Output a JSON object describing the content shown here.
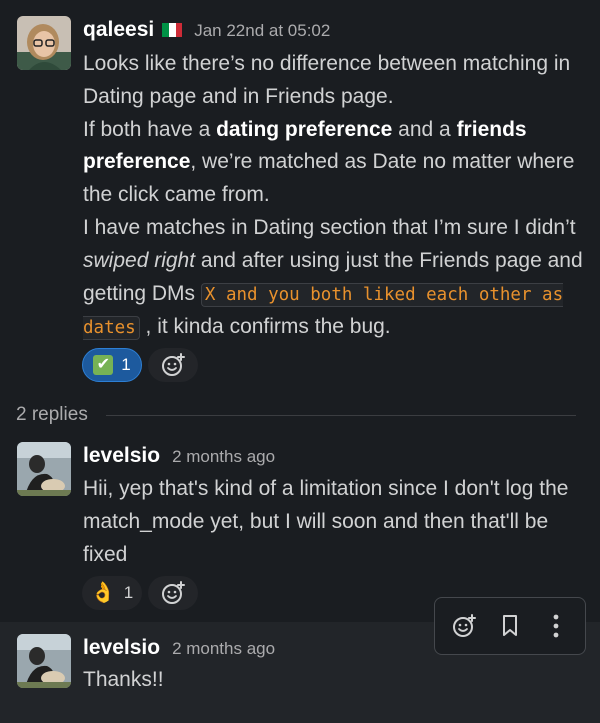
{
  "message1": {
    "author": "qaleesi",
    "flag_colors": [
      "#009246",
      "#ffffff",
      "#ce2b37"
    ],
    "timestamp": "Jan 22nd at 05:02",
    "p1": "Looks like there’s no difference between matching in Dating page and in Friends page.",
    "p2_a": "If both have a ",
    "p2_b": "dating preference",
    "p2_c": " and a ",
    "p2_d": "friends preference",
    "p2_e": ", we’re matched as Date no matter where the click came from.",
    "p3_a": "I have matches in Dating section that I’m sure I didn’t ",
    "p3_b": "swiped right",
    "p3_c": " and after using just the Friends page and getting DMs ",
    "p3_code": "X and you both liked each other as dates",
    "p3_d": " , it kinda  confirms the bug.",
    "reaction": {
      "emoji": "✔",
      "count": "1"
    }
  },
  "thread": {
    "replies_label": "2 replies"
  },
  "reply1": {
    "author": "levelsio",
    "timestamp": "2 months ago",
    "text": "Hii, yep that's kind of a limitation since I don't log the match_mode yet, but I will soon and then that'll be fixed",
    "reaction": {
      "emoji": "👌",
      "count": "1"
    }
  },
  "reply2": {
    "author": "levelsio",
    "timestamp": "2 months ago",
    "text": "Thanks!!"
  },
  "colors": {
    "accent": "#1d5a9e",
    "code": "#e8912d",
    "background": "#1a1d21"
  }
}
